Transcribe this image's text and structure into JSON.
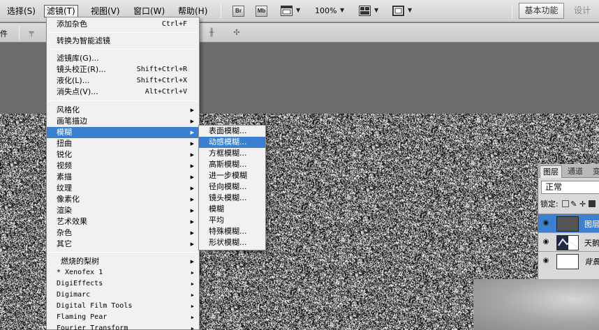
{
  "menubar": {
    "items": [
      "选择(S)",
      "滤镜(T)",
      "视图(V)",
      "窗口(W)",
      "帮助(H)"
    ],
    "active": "滤镜(T)",
    "bridge_label": "Br",
    "minibridge_label": "Mb",
    "zoom": "100%",
    "workspace": "基本功能",
    "design": "设计"
  },
  "options_bar": {
    "label": "件"
  },
  "filter_menu": {
    "items": [
      {
        "label": "添加杂色",
        "shortcut": "Ctrl+F"
      },
      {
        "label": "转换为智能滤镜"
      },
      {
        "label": "滤镜库(G)..."
      },
      {
        "label": "镜头校正(R)...",
        "shortcut": "Shift+Ctrl+R"
      },
      {
        "label": "液化(L)...",
        "shortcut": "Shift+Ctrl+X"
      },
      {
        "label": "消失点(V)...",
        "shortcut": "Alt+Ctrl+V"
      },
      {
        "label": "风格化"
      },
      {
        "label": "画笔描边"
      },
      {
        "label": "模糊"
      },
      {
        "label": "扭曲"
      },
      {
        "label": "锐化"
      },
      {
        "label": "视频"
      },
      {
        "label": "素描"
      },
      {
        "label": "纹理"
      },
      {
        "label": "像素化"
      },
      {
        "label": "渲染"
      },
      {
        "label": "艺术效果"
      },
      {
        "label": "杂色"
      },
      {
        "label": "其它"
      },
      {
        "label": "燃烧的梨树"
      },
      {
        "label": "* Xenofex 1"
      },
      {
        "label": "DigiEffects"
      },
      {
        "label": "Digimarc"
      },
      {
        "label": "Digital Film Tools"
      },
      {
        "label": "Flaming Pear"
      },
      {
        "label": "Fourier Transform"
      }
    ]
  },
  "blur_submenu": {
    "items": [
      "表面模糊...",
      "动感模糊...",
      "方框模糊...",
      "高斯模糊...",
      "进一步模糊",
      "径向模糊...",
      "镜头模糊...",
      "模糊",
      "平均",
      "特殊模糊...",
      "形状模糊..."
    ],
    "highlighted": "动感模糊..."
  },
  "layers_panel": {
    "tabs": [
      "图层",
      "通道",
      "变"
    ],
    "blend_mode": "正常",
    "lock_label": "锁定:",
    "layers": [
      {
        "name": "图层",
        "selected": true
      },
      {
        "name": "天鹅"
      },
      {
        "name": "背景"
      }
    ]
  }
}
